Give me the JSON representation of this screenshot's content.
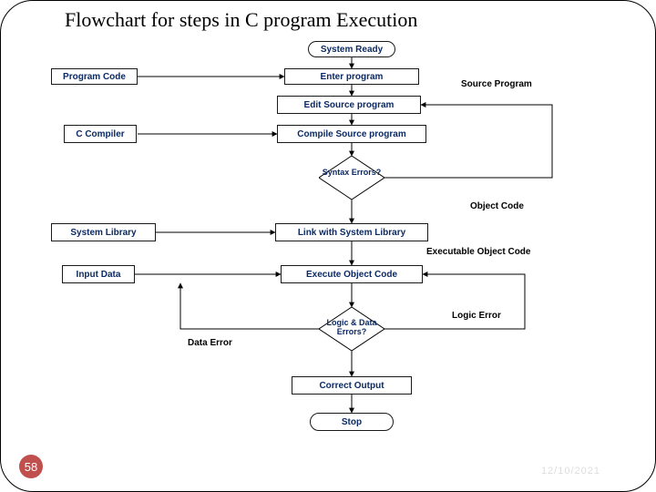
{
  "title": "Flowchart for steps in C program Execution",
  "page": "58",
  "date": "12/10/2021",
  "nodes": {
    "system_ready": "System Ready",
    "enter_program": "Enter program",
    "edit_source": "Edit Source program",
    "compile_source": "Compile Source program",
    "syntax_errors": "Syntax\nErrors?",
    "link_lib": "Link with System Library",
    "execute_obj": "Execute Object Code",
    "logic_data_errors": "Logic & Data\nErrors?",
    "correct_output": "Correct Output",
    "stop": "Stop",
    "program_code": "Program Code",
    "c_compiler": "C Compiler",
    "system_library": "System Library",
    "input_data": "Input Data"
  },
  "side_labels": {
    "source_program": "Source Program",
    "object_code": "Object Code",
    "exec_obj_code": "Executable Object Code",
    "data_error": "Data Error",
    "logic_error": "Logic Error"
  }
}
